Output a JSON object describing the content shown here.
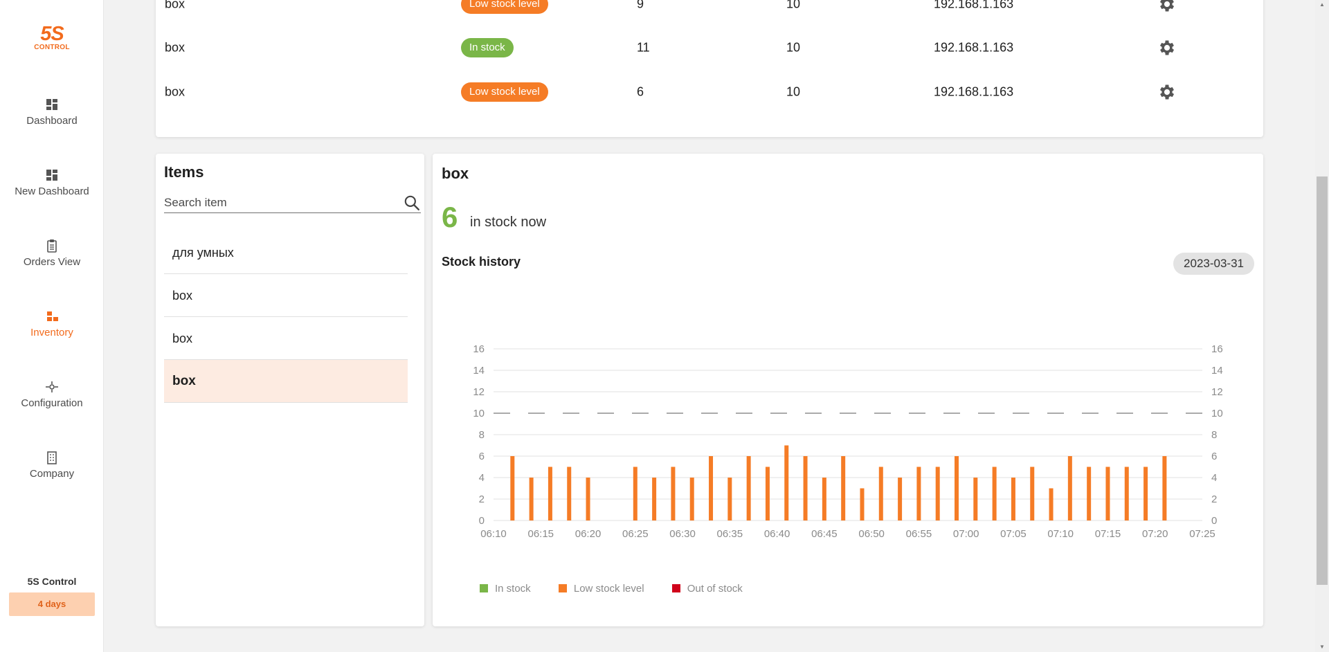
{
  "app": {
    "logo_top": "5S",
    "logo_bottom": "CONTROL",
    "nav": [
      {
        "label": "Dashboard",
        "icon": "dashboard-icon"
      },
      {
        "label": "New Dashboard",
        "icon": "dashboard-icon"
      },
      {
        "label": "Orders View",
        "icon": "clipboard-icon"
      },
      {
        "label": "Inventory",
        "icon": "inventory-icon"
      },
      {
        "label": "Configuration",
        "icon": "configuration-icon"
      },
      {
        "label": "Company",
        "icon": "building-icon"
      }
    ],
    "active_nav": "Inventory",
    "trial_title": "5S Control",
    "trial_badge": "4 days"
  },
  "colors": {
    "brand": "#f26b1d",
    "in_stock": "#7ab648",
    "low_stock": "#f57c26",
    "out_of_stock": "#d0021b"
  },
  "table": {
    "rows": [
      {
        "name": "box",
        "status": "Low stock level",
        "status_color": "#f57c26",
        "current": "9",
        "limit": "10",
        "ip": "192.168.1.163"
      },
      {
        "name": "box",
        "status": "In stock",
        "status_color": "#7ab648",
        "current": "11",
        "limit": "10",
        "ip": "192.168.1.163"
      },
      {
        "name": "box",
        "status": "Low stock level",
        "status_color": "#f57c26",
        "current": "6",
        "limit": "10",
        "ip": "192.168.1.163"
      }
    ]
  },
  "items": {
    "title": "Items",
    "search_placeholder": "Search item",
    "list": [
      "для умных",
      "box",
      "box",
      "box"
    ],
    "selected_index": 3
  },
  "detail": {
    "title": "box",
    "stock_count": "6",
    "stock_text": "in stock now",
    "history_title": "Stock history",
    "date": "2023-03-31"
  },
  "chart_data": {
    "type": "bar",
    "title": "",
    "xlabel": "",
    "ylabel": "",
    "ylim": [
      0,
      16
    ],
    "y_ticks": [
      0,
      2,
      4,
      6,
      8,
      10,
      12,
      14,
      16
    ],
    "x_ticks": [
      "06:10",
      "06:15",
      "06:20",
      "06:25",
      "06:30",
      "06:35",
      "06:40",
      "06:45",
      "06:50",
      "06:55",
      "07:00",
      "07:05",
      "07:10",
      "07:15",
      "07:20",
      "07:25"
    ],
    "x_range": [
      "06:10",
      "07:25"
    ],
    "grid": true,
    "threshold_line": {
      "value": 10,
      "style": "dashed"
    },
    "series": [
      {
        "name": "Low stock level",
        "color": "#f57c26",
        "x": [
          "06:12",
          "06:14",
          "06:16",
          "06:18",
          "06:20",
          "06:25",
          "06:27",
          "06:29",
          "06:31",
          "06:33",
          "06:35",
          "06:37",
          "06:39",
          "06:41",
          "06:43",
          "06:45",
          "06:47",
          "06:49",
          "06:51",
          "06:53",
          "06:55",
          "06:57",
          "06:59",
          "07:01",
          "07:03",
          "07:05",
          "07:07",
          "07:09",
          "07:11",
          "07:13",
          "07:15",
          "07:17",
          "07:19",
          "07:21"
        ],
        "values": [
          6,
          4,
          5,
          5,
          4,
          5,
          4,
          5,
          4,
          6,
          4,
          6,
          5,
          7,
          6,
          4,
          6,
          3,
          5,
          4,
          5,
          5,
          6,
          4,
          5,
          4,
          5,
          3,
          6,
          5,
          5,
          5,
          5,
          6
        ]
      }
    ],
    "legend": [
      "In stock",
      "Low stock level",
      "Out of stock"
    ],
    "legend_position": "bottom-left"
  }
}
